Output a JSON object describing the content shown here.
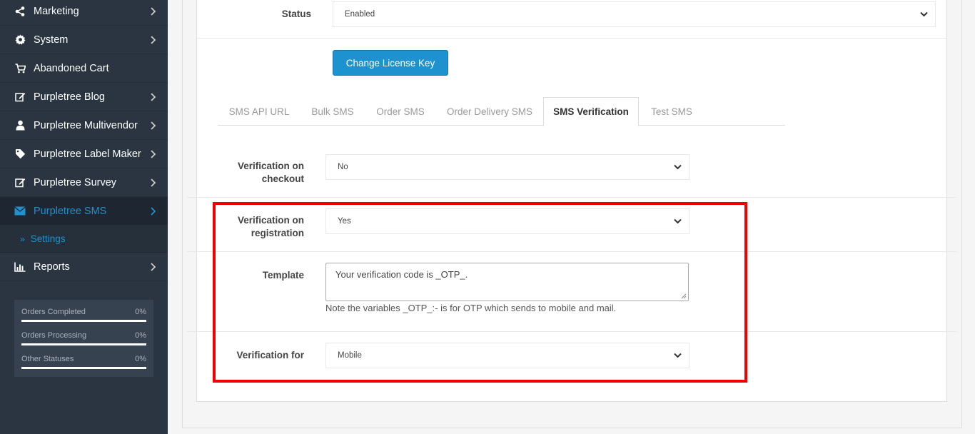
{
  "sidebar": {
    "items": [
      {
        "label": "Marketing",
        "icon": "share-icon"
      },
      {
        "label": "System",
        "icon": "gear-icon"
      },
      {
        "label": "Abandoned Cart",
        "icon": "cart-icon"
      },
      {
        "label": "Purpletree Blog",
        "icon": "edit-icon"
      },
      {
        "label": "Purpletree Multivendor",
        "icon": "user-icon"
      },
      {
        "label": "Purpletree Label Maker",
        "icon": "tag-icon"
      },
      {
        "label": "Purpletree Survey",
        "icon": "edit-icon"
      },
      {
        "label": "Purpletree SMS",
        "icon": "envelope-icon"
      }
    ],
    "sub_item": "Settings",
    "sub_arrow": "»",
    "reports": "Reports",
    "stats": [
      {
        "label": "Orders Completed",
        "value": "0%"
      },
      {
        "label": "Orders Processing",
        "value": "0%"
      },
      {
        "label": "Other Statuses",
        "value": "0%"
      }
    ]
  },
  "status": {
    "label": "Status",
    "value": "Enabled"
  },
  "change_key_label": "Change License Key",
  "tabs": [
    "SMS API URL",
    "Bulk SMS",
    "Order SMS",
    "Order Delivery SMS",
    "SMS Verification",
    "Test SMS"
  ],
  "form": {
    "verification_checkout": {
      "label_line1": "Verification on",
      "label_line2": "checkout",
      "value": "No"
    },
    "verification_registration": {
      "label_line1": "Verification on",
      "label_line2": "registration",
      "value": "Yes"
    },
    "template": {
      "label": "Template",
      "value": "Your verification code is _OTP_.",
      "help": "Note the variables _OTP_:- is for OTP which sends to mobile and mail."
    },
    "verification_for": {
      "label": "Verification for",
      "value": "Mobile"
    }
  },
  "colors": {
    "sidebar_bg": "#2b3541",
    "accent": "#1e91cf",
    "highlight": "#ef0000"
  }
}
